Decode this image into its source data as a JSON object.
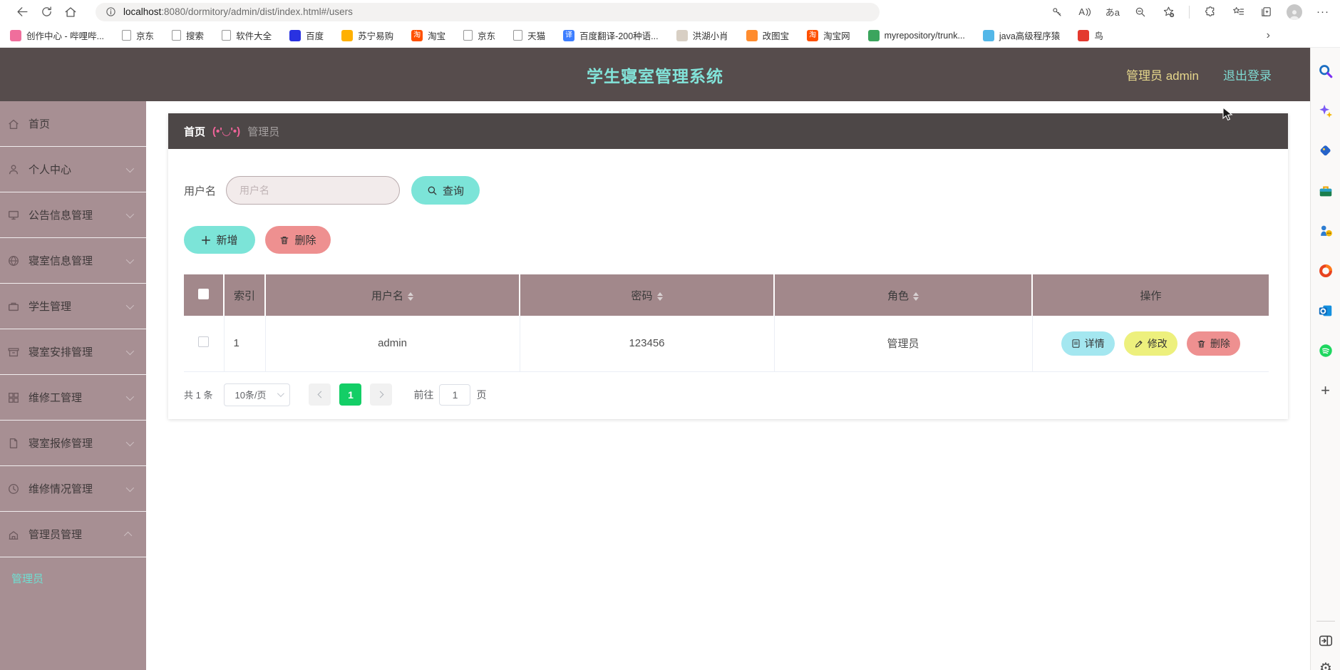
{
  "browser": {
    "url_host": "localhost",
    "url_rest": ":8080/dormitory/admin/dist/index.html#/users",
    "bookmarks": [
      {
        "label": "创作中心 - 哔哩哔...",
        "glyph": "",
        "color": "#f06e9c"
      },
      {
        "label": "京东",
        "glyph": "",
        "color": ""
      },
      {
        "label": "搜索",
        "glyph": "",
        "color": ""
      },
      {
        "label": "软件大全",
        "glyph": "",
        "color": ""
      },
      {
        "label": "百度",
        "glyph": "",
        "color": "#2932e1"
      },
      {
        "label": "苏宁易购",
        "glyph": "",
        "color": "#ffb000"
      },
      {
        "label": "淘宝",
        "glyph": "淘",
        "color": "#ff5000"
      },
      {
        "label": "京东",
        "glyph": "",
        "color": ""
      },
      {
        "label": "天猫",
        "glyph": "",
        "color": ""
      },
      {
        "label": "百度翻译-200种语...",
        "glyph": "译",
        "color": "#3d7eff"
      },
      {
        "label": "洪湖小肖",
        "glyph": "",
        "color": "#d8cfc4"
      },
      {
        "label": "改图宝",
        "glyph": "",
        "color": "#ff8c2e"
      },
      {
        "label": "淘宝网",
        "glyph": "淘",
        "color": "#ff5000"
      },
      {
        "label": "myrepository/trunk...",
        "glyph": "",
        "color": "#3ba55d"
      },
      {
        "label": "java高级程序猿",
        "glyph": "",
        "color": "#53b7e8"
      },
      {
        "label": "鸟",
        "glyph": "",
        "color": "#e4392e"
      }
    ]
  },
  "glyphs": {
    "overflow_chevron": "›",
    "more": "···",
    "read_aloud": "A",
    "translate": "あa",
    "strip_plus": "+",
    "gear": "⚙"
  },
  "edge_sidebar": {
    "icons": [
      "search",
      "copilot",
      "shopping",
      "toolbox",
      "games",
      "office",
      "outlook",
      "spotify",
      "add",
      "open-panel",
      "settings"
    ]
  },
  "app_header": {
    "title": "学生寝室管理系统",
    "user_label": "管理员 admin",
    "logout_label": "退出登录"
  },
  "sidebar": {
    "items": [
      {
        "label": "首页"
      },
      {
        "label": "个人中心"
      },
      {
        "label": "公告信息管理"
      },
      {
        "label": "寝室信息管理"
      },
      {
        "label": "学生管理"
      },
      {
        "label": "寝室安排管理"
      },
      {
        "label": "维修工管理"
      },
      {
        "label": "寝室报修管理"
      },
      {
        "label": "维修情况管理"
      },
      {
        "label": "管理员管理"
      }
    ],
    "submenu_active": "管理员"
  },
  "breadcrumb": {
    "home": "首页",
    "emoticon": "(•'◡'•)",
    "current": "管理员"
  },
  "filters": {
    "username_label": "用户名",
    "username_placeholder": "用户名",
    "search_button": "查询"
  },
  "toolbar": {
    "add_label": "新增",
    "delete_label": "删除"
  },
  "table": {
    "columns": [
      "索引",
      "用户名",
      "密码",
      "角色",
      "操作"
    ],
    "rows": [
      {
        "index": "1",
        "username": "admin",
        "password": "123456",
        "role": "管理员"
      }
    ],
    "action_labels": [
      "详情",
      "修改",
      "删除"
    ]
  },
  "pagination": {
    "total_text": "共 1 条",
    "page_size_text": "10条/页",
    "current_page": "1",
    "goto_label": "前往",
    "goto_value": "1",
    "page_unit": "页"
  },
  "colors": {
    "header_bg": "#564c4c",
    "sidebar_bg": "#a78f93",
    "table_header_bg": "#a2888b",
    "teal": "#7ce4d8",
    "salmon": "#ee9090",
    "yellow": "#edf07d",
    "cyan": "#a4e7f0",
    "pager_green": "#13ce66",
    "title_teal": "#82e3d9",
    "user_yellow": "#e6d78c"
  }
}
